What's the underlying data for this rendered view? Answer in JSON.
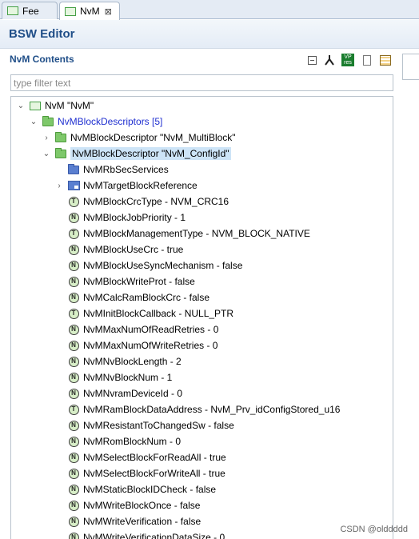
{
  "tabs": [
    {
      "label": "Fee",
      "active": false
    },
    {
      "label": "NvM",
      "active": true,
      "close_glyph": "⊠"
    }
  ],
  "header": {
    "title": "BSW Editor"
  },
  "section": {
    "title": "NvM Contents"
  },
  "toolbar": {
    "icons": [
      "collapse-all-icon",
      "hierarchy-icon",
      "vp-res-icon",
      "document-icon",
      "layout-icon"
    ],
    "vp_res_text": "VP\nres"
  },
  "filter": {
    "placeholder": "type filter text",
    "value": ""
  },
  "tree": {
    "root": {
      "label": "NvM \"NvM\"",
      "expanded": true
    },
    "descriptors": {
      "label": "NvMBlockDescriptors [5]",
      "expanded": true
    },
    "multiblock": {
      "label": "NvMBlockDescriptor \"NvM_MultiBlock\"",
      "expanded": false
    },
    "configid": {
      "label": "NvMBlockDescriptor \"NvM_ConfigId\"",
      "expanded": true,
      "selected": true
    },
    "children": [
      {
        "label": "NvMRbSecServices",
        "icon": "folder-blue-icon",
        "badge": ""
      },
      {
        "label": "NvMTargetBlockReference",
        "icon": "reference-icon",
        "badge": "",
        "expandable": true
      },
      {
        "label": "NvMBlockCrcType - NVM_CRC16",
        "icon": "text-param-icon",
        "badge": "T"
      },
      {
        "label": "NvMBlockJobPriority - 1",
        "icon": "numeric-param-icon",
        "badge": "N"
      },
      {
        "label": "NvMBlockManagementType - NVM_BLOCK_NATIVE",
        "icon": "text-param-icon",
        "badge": "T"
      },
      {
        "label": "NvMBlockUseCrc - true",
        "icon": "numeric-param-icon",
        "badge": "N"
      },
      {
        "label": "NvMBlockUseSyncMechanism - false",
        "icon": "numeric-param-icon",
        "badge": "N"
      },
      {
        "label": "NvMBlockWriteProt - false",
        "icon": "numeric-param-icon",
        "badge": "N"
      },
      {
        "label": "NvMCalcRamBlockCrc - false",
        "icon": "numeric-param-icon",
        "badge": "N"
      },
      {
        "label": "NvMInitBlockCallback - NULL_PTR",
        "icon": "text-param-icon",
        "badge": "T"
      },
      {
        "label": "NvMMaxNumOfReadRetries - 0",
        "icon": "numeric-param-icon",
        "badge": "N"
      },
      {
        "label": "NvMMaxNumOfWriteRetries - 0",
        "icon": "numeric-param-icon",
        "badge": "N"
      },
      {
        "label": "NvMNvBlockLength - 2",
        "icon": "numeric-param-icon",
        "badge": "N"
      },
      {
        "label": "NvMNvBlockNum - 1",
        "icon": "numeric-param-icon",
        "badge": "N"
      },
      {
        "label": "NvMNvramDeviceId - 0",
        "icon": "numeric-param-icon",
        "badge": "N"
      },
      {
        "label": "NvMRamBlockDataAddress - NvM_Prv_idConfigStored_u16",
        "icon": "text-param-icon",
        "badge": "T"
      },
      {
        "label": "NvMResistantToChangedSw - false",
        "icon": "numeric-param-icon",
        "badge": "N"
      },
      {
        "label": "NvMRomBlockNum - 0",
        "icon": "numeric-param-icon",
        "badge": "N"
      },
      {
        "label": "NvMSelectBlockForReadAll - true",
        "icon": "numeric-param-icon",
        "badge": "N"
      },
      {
        "label": "NvMSelectBlockForWriteAll - true",
        "icon": "numeric-param-icon",
        "badge": "N"
      },
      {
        "label": "NvMStaticBlockIDCheck - false",
        "icon": "numeric-param-icon",
        "badge": "N"
      },
      {
        "label": "NvMWriteBlockOnce - false",
        "icon": "numeric-param-icon",
        "badge": "N"
      },
      {
        "label": "NvMWriteVerification - false",
        "icon": "numeric-param-icon",
        "badge": "N"
      },
      {
        "label": "NvMWriteVerificationDataSize - 0",
        "icon": "numeric-param-icon",
        "badge": "N"
      }
    ]
  },
  "watermark": "CSDN @olddddd"
}
